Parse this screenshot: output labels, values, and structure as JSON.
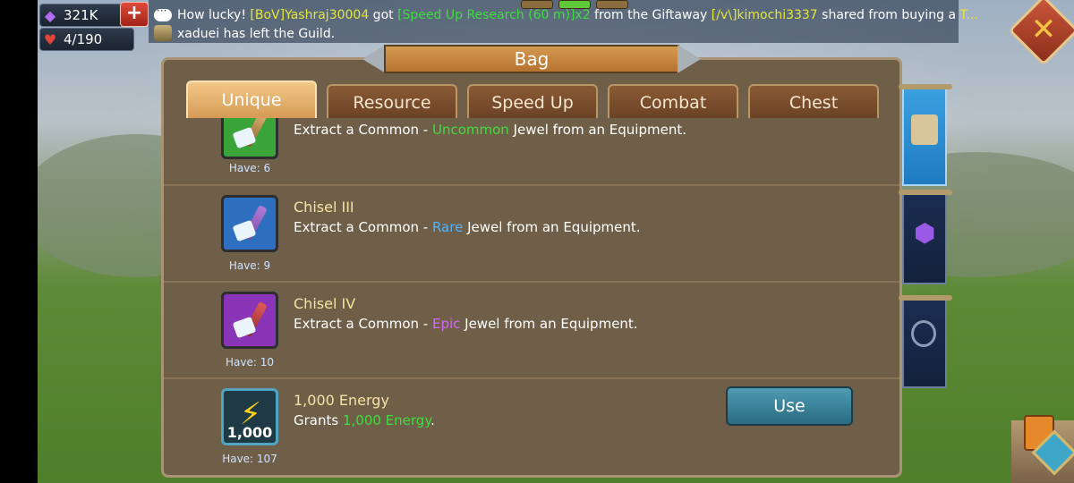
{
  "hud": {
    "gems": "321K",
    "hearts": "4/190",
    "plus": "+"
  },
  "chat": {
    "line1": {
      "p1": "How lucky! ",
      "player": "[BoV]Yashraj30004",
      "p2": " got ",
      "item": "[Speed Up Research (60 m)]x2",
      "p3": " from the Giftaway ",
      "giver": "[/v\\]kimochi3337",
      "p4": " shared from buying a ",
      "tail": "T..."
    },
    "line2": "xaduei has left the Guild."
  },
  "window": {
    "title": "Bag"
  },
  "tabs": [
    {
      "label": "Unique",
      "active": true
    },
    {
      "label": "Resource",
      "active": false
    },
    {
      "label": "Speed Up",
      "active": false
    },
    {
      "label": "Combat",
      "active": false
    },
    {
      "label": "Chest",
      "active": false
    }
  ],
  "items": [
    {
      "name": "",
      "desc_pre": "Extract a Common - ",
      "desc_rarity": "Uncommon",
      "desc_post": " Jewel from an Equipment.",
      "have": "Have: 6",
      "icon": "green-chisel-icon",
      "color": "#3aa33a"
    },
    {
      "name": "Chisel III",
      "desc_pre": "Extract a Common - ",
      "desc_rarity": "Rare",
      "desc_post": " Jewel from an Equipment.",
      "have": "Have: 9",
      "icon": "blue-chisel-icon",
      "color": "#2f6fc0"
    },
    {
      "name": "Chisel IV",
      "desc_pre": "Extract a Common - ",
      "desc_rarity": "Epic",
      "desc_post": " Jewel from an Equipment.",
      "have": "Have: 10",
      "icon": "purple-chisel-icon",
      "color": "#8a34b8"
    },
    {
      "name": "1,000 Energy",
      "desc_pre": "Grants ",
      "desc_rarity": "1,000 Energy",
      "desc_post": ".",
      "have": "Have: 107",
      "icon": "energy-bolt-icon",
      "amount": "1,000",
      "use_label": "Use",
      "color": "#1f3a44"
    }
  ],
  "side_tabs": [
    {
      "icon": "scroll-map-icon",
      "active": true
    },
    {
      "icon": "purple-gem-icon",
      "active": false
    },
    {
      "icon": "shield-icon",
      "active": false
    }
  ]
}
